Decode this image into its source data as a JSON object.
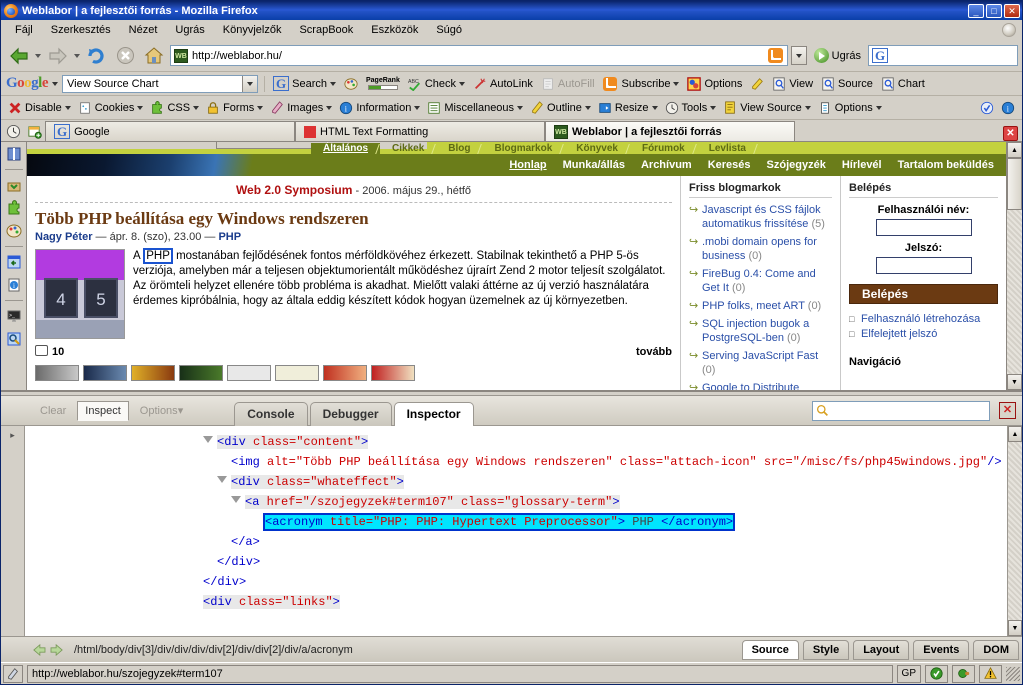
{
  "window": {
    "title": "Weblabor | a fejlesztői forrás - Mozilla Firefox",
    "minimize": "_",
    "maximize": "□",
    "close": "✕"
  },
  "menubar": {
    "items": [
      "Fájl",
      "Szerkesztés",
      "Nézet",
      "Ugrás",
      "Könyvjelzők",
      "ScrapBook",
      "Eszközök",
      "Súgó"
    ]
  },
  "navbar": {
    "back": "Vissza",
    "forward": "Előre",
    "reload": "Frissítés",
    "stop": "Leállítás",
    "home": "Kezdőlap",
    "url": "http://weblabor.hu/",
    "favicon_label": "WB",
    "go_label": "Ugrás",
    "search_value": "",
    "search_icon": "google-icon"
  },
  "google_toolbar": {
    "logo": "Google",
    "select_value": "View Source Chart",
    "items": [
      {
        "label": "Search",
        "icon": "google-g-icon",
        "caret": true
      },
      {
        "label": "",
        "icon": "palette-icon",
        "caret": false
      },
      {
        "label": "PageRank",
        "icon": "pagerank-icon",
        "caret": false
      },
      {
        "label": "Check",
        "icon": "abc-check-icon",
        "caret": true
      },
      {
        "label": "AutoLink",
        "icon": "autolink-icon",
        "caret": false
      },
      {
        "label": "AutoFill",
        "icon": "autofill-icon",
        "caret": false,
        "disabled": true
      },
      {
        "label": "Subscribe",
        "icon": "rss-icon",
        "caret": true
      },
      {
        "label": "Options",
        "icon": "options-icon",
        "caret": false
      },
      {
        "label": "",
        "icon": "highlighter-icon",
        "caret": false
      },
      {
        "label": "View",
        "icon": "view-source-chart-icon",
        "caret": false
      },
      {
        "label": "Source",
        "icon": "view-source-chart-icon",
        "caret": false
      },
      {
        "label": "Chart",
        "icon": "view-source-chart-icon",
        "caret": false
      }
    ]
  },
  "webdev_toolbar": {
    "items": [
      {
        "label": "Disable",
        "icon": "disable-x-icon",
        "caret": true
      },
      {
        "label": "Cookies",
        "icon": "cookies-icon",
        "caret": true
      },
      {
        "label": "CSS",
        "icon": "css-puzzle-icon",
        "caret": true
      },
      {
        "label": "Forms",
        "icon": "forms-lock-icon",
        "caret": true
      },
      {
        "label": "Images",
        "icon": "images-icon",
        "caret": true
      },
      {
        "label": "Information",
        "icon": "information-icon",
        "caret": true
      },
      {
        "label": "Miscellaneous",
        "icon": "miscellaneous-icon",
        "caret": true
      },
      {
        "label": "Outline",
        "icon": "outline-pen-icon",
        "caret": true
      },
      {
        "label": "Resize",
        "icon": "resize-icon",
        "caret": true
      },
      {
        "label": "Tools",
        "icon": "tools-clock-icon",
        "caret": true
      },
      {
        "label": "View Source",
        "icon": "view-source-icon",
        "caret": true
      },
      {
        "label": "Options",
        "icon": "options-list-icon",
        "caret": true
      }
    ],
    "right_icons": [
      "validate-check-icon",
      "info-icon"
    ]
  },
  "tabbar": {
    "history_icon": "history-clock-icon",
    "newtab_icon": "new-tab-icon",
    "tabs": [
      {
        "label": "Google",
        "icon": "google-favicon",
        "active": false
      },
      {
        "label": "HTML Text Formatting",
        "icon": "red-favicon",
        "active": false
      },
      {
        "label": "Weblabor | a fejlesztői forrás",
        "icon": "weblabor-favicon",
        "active": true
      }
    ],
    "close_tab": "✕"
  },
  "sidebar_icons": [
    {
      "name": "history-clock-icon"
    },
    {
      "name": "bookmarks-book-icon"
    },
    {
      "name": "scrapbook-box-icon"
    },
    {
      "name": "css-puzzle-icon"
    },
    {
      "name": "palette-icon"
    },
    {
      "name": "window-panel-icon"
    },
    {
      "name": "page-info-icon"
    },
    {
      "name": "console-monitor-icon"
    },
    {
      "name": "inspect-magnifier-icon"
    }
  ],
  "site": {
    "top_tabs": [
      {
        "label": "Általános",
        "selected": true
      },
      {
        "label": "Cikkek",
        "selected": false
      },
      {
        "label": "Blog",
        "selected": false
      },
      {
        "label": "Blogmarkok",
        "selected": false
      },
      {
        "label": "Könyvek",
        "selected": false
      },
      {
        "label": "Fórumok",
        "selected": false
      },
      {
        "label": "Levlista",
        "selected": false
      }
    ],
    "nav": [
      {
        "label": "Honlap",
        "current": true
      },
      {
        "label": "Munka/állás",
        "current": false
      },
      {
        "label": "Archívum",
        "current": false
      },
      {
        "label": "Keresés",
        "current": false
      },
      {
        "label": "Szójegyzék",
        "current": false
      },
      {
        "label": "Hírlevél",
        "current": false
      },
      {
        "label": "Tartalom beküldés",
        "current": false
      }
    ],
    "symposium": {
      "title": "Web 2.0 Symposium",
      "date": "- 2006. május 29., hétfő"
    },
    "article": {
      "title": "Több PHP beállítása egy Windows rendszeren",
      "author": "Nagy Péter",
      "meta_date": "— ápr. 8. (szo), 23.00 —",
      "category": "PHP",
      "body_before": "A ",
      "body_highlight": "PHP",
      "body_after": " mostanában fejlődésének fontos mérföldkövéhez érkezett. Stabilnak tekinthető a PHP 5-ös verziója, amelyben már a teljesen objektumorientált működéshez újraírt Zend 2 motor teljesít szolgálatot. Az örömteli helyzet ellenére több probléma is akadhat. Mielőtt valaki áttérne az új verzió használatára érdemes kipróbálnia, hogy az általa eddig készített kódok hogyan üzemelnek az új környezetben.",
      "comments": "10",
      "more": "tovább",
      "thumb_left": "4",
      "thumb_right": "5"
    },
    "blogmarks": {
      "heading": "Friss blogmarkok",
      "items": [
        {
          "text": "Javascript és CSS fájlok automatikus frissítése",
          "count": "(5)"
        },
        {
          "text": ".mobi domain opens for business",
          "count": "(0)"
        },
        {
          "text": "FireBug 0.4: Come and Get It",
          "count": "(0)"
        },
        {
          "text": "PHP folks, meet ART",
          "count": "(0)"
        },
        {
          "text": "SQL injection bugok a PostgreSQL-ben",
          "count": "(0)"
        },
        {
          "text": "Serving JavaScript Fast",
          "count": "(0)"
        },
        {
          "text": "Google to Distribute",
          "count": ""
        }
      ]
    },
    "login": {
      "heading": "Belépés",
      "username_label": "Felhasználói név:",
      "username_value": "",
      "password_label": "Jelszó:",
      "password_value": "",
      "submit": "Belépés",
      "links": [
        "Felhasználó létrehozása",
        "Elfelejtett jelszó"
      ],
      "nav_heading": "Navigáció"
    }
  },
  "firebug": {
    "toolbar": {
      "clear": "Clear",
      "inspect": "Inspect",
      "options": "Options",
      "search_value": "",
      "search_icon": "magnifier-icon",
      "close": "✕"
    },
    "tabs": [
      {
        "label": "Console",
        "active": false
      },
      {
        "label": "Debugger",
        "active": false
      },
      {
        "label": "Inspector",
        "active": true
      }
    ],
    "code_lines": [
      {
        "indent": 0,
        "twisty": true,
        "highlight": true,
        "parts": [
          {
            "t": "tag",
            "s": "<div "
          },
          {
            "t": "tag",
            "s": "class="
          },
          {
            "t": "val",
            "s": "\"content\""
          },
          {
            "t": "tag",
            "s": ">"
          }
        ]
      },
      {
        "indent": 1,
        "twisty": false,
        "highlight": false,
        "parts": [
          {
            "t": "tag",
            "s": "<img "
          },
          {
            "t": "attr",
            "s": "alt="
          },
          {
            "t": "val",
            "s": "\"Több PHP beállítása egy Windows rendszeren\""
          },
          {
            "t": "attr",
            "s": " class="
          },
          {
            "t": "val",
            "s": "\"attach-icon\""
          },
          {
            "t": "attr",
            "s": " src="
          },
          {
            "t": "val",
            "s": "\"/misc/fs/php45windows.jpg\""
          },
          {
            "t": "tag",
            "s": "/>"
          }
        ]
      },
      {
        "indent": 1,
        "twisty": true,
        "highlight": true,
        "parts": [
          {
            "t": "tag",
            "s": "<div "
          },
          {
            "t": "attr",
            "s": "class="
          },
          {
            "t": "val",
            "s": "\"whateffect\""
          },
          {
            "t": "tag",
            "s": ">"
          }
        ]
      },
      {
        "indent": 2,
        "twisty": true,
        "highlight": true,
        "parts": [
          {
            "t": "tag",
            "s": "<a "
          },
          {
            "t": "attr",
            "s": "href="
          },
          {
            "t": "val",
            "s": "\"/szojegyzek#term107\""
          },
          {
            "t": "attr",
            "s": " class="
          },
          {
            "t": "val",
            "s": "\"glossary-term\""
          },
          {
            "t": "tag",
            "s": ">"
          }
        ]
      },
      {
        "indent": 3,
        "twisty": false,
        "selected": true,
        "parts": [
          {
            "t": "tag",
            "s": "<acronym "
          },
          {
            "t": "attr",
            "s": "title="
          },
          {
            "t": "val",
            "s": "\"PHP: PHP: Hypertext Preprocessor\""
          },
          {
            "t": "tag",
            "s": ">"
          },
          {
            "t": "txt",
            "s": "PHP"
          },
          {
            "t": "tag",
            "s": "</acronym>"
          }
        ]
      },
      {
        "indent": 2,
        "twisty": false,
        "highlight": false,
        "parts": [
          {
            "t": "tag",
            "s": "</a>"
          }
        ]
      },
      {
        "indent": 1,
        "twisty": false,
        "highlight": false,
        "parts": [
          {
            "t": "tag",
            "s": "</div>"
          }
        ]
      },
      {
        "indent": 0,
        "twisty": false,
        "highlight": false,
        "parts": [
          {
            "t": "tag",
            "s": "</div>"
          }
        ]
      },
      {
        "indent": 0,
        "twisty": false,
        "highlight": true,
        "parts": [
          {
            "t": "tag",
            "s": "<div "
          },
          {
            "t": "attr",
            "s": "class="
          },
          {
            "t": "val",
            "s": "\"links\""
          },
          {
            "t": "tag",
            "s": ">"
          }
        ]
      }
    ],
    "status": {
      "breadcrumb": "/html/body/div[3]/div/div/div/div[2]/div/div[2]/div/a/acronym",
      "tabs": [
        {
          "label": "Source",
          "active": true
        },
        {
          "label": "Style",
          "active": false
        },
        {
          "label": "Layout",
          "active": false
        },
        {
          "label": "Events",
          "active": false
        },
        {
          "label": "DOM",
          "active": false
        }
      ]
    }
  },
  "statusbar": {
    "url": "http://weblabor.hu/szojegyzek#term107",
    "gp": "GP",
    "icons": [
      "shield-check-icon",
      "globe-icon",
      "warning-icon"
    ]
  },
  "colors": {
    "title_blue": "#0a246a",
    "chrome": "#d4d0c8",
    "site_green": "#6b7d1a",
    "site_lime": "#c3d13f",
    "article_brown": "#6b3a12",
    "link_blue": "#2a4fa8",
    "selection_cyan": "#00e5ff",
    "tag_blue": "#0000cc",
    "attr_red": "#cc0000"
  }
}
